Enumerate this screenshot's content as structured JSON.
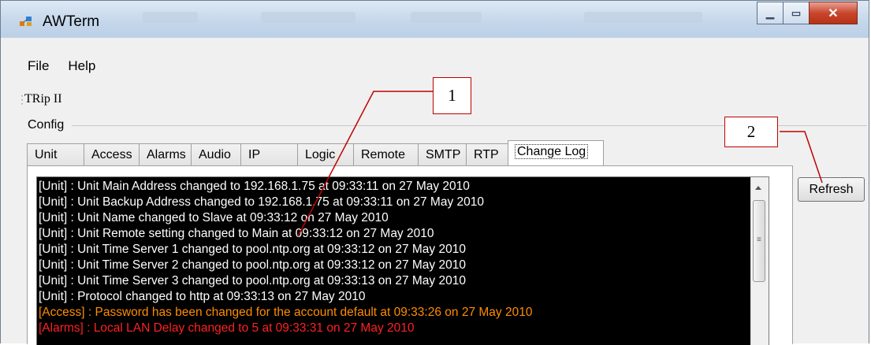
{
  "window": {
    "title": "AWTerm"
  },
  "menu": {
    "items": [
      "File",
      "Help"
    ]
  },
  "toolstrip": {
    "item": "TRip II"
  },
  "group": {
    "label": "Config"
  },
  "tabs": [
    "Unit",
    "Access",
    "Alarms",
    "Audio",
    "IP",
    "Logic",
    "Remote",
    "SMTP",
    "RTP",
    "Change Log"
  ],
  "active_tab": "Change Log",
  "log": [
    {
      "text": "[Unit] : Unit Main Address changed to 192.168.1.75 at 09:33:11 on 27 May 2010",
      "color": "#ffffff"
    },
    {
      "text": "[Unit] : Unit Backup Address changed to 192.168.1.75 at 09:33:11 on 27 May 2010",
      "color": "#ffffff"
    },
    {
      "text": "[Unit] : Unit Name changed to Slave at 09:33:12 on 27 May 2010",
      "color": "#ffffff"
    },
    {
      "text": "[Unit] : Unit Remote setting changed to Main at 09:33:12 on 27 May 2010",
      "color": "#ffffff"
    },
    {
      "text": "[Unit] : Unit Time Server 1 changed to pool.ntp.org at 09:33:12 on 27 May 2010",
      "color": "#ffffff"
    },
    {
      "text": "[Unit] : Unit Time Server 2 changed to pool.ntp.org at 09:33:12 on 27 May 2010",
      "color": "#ffffff"
    },
    {
      "text": "[Unit] : Unit Time Server 3 changed to pool.ntp.org at 09:33:13 on 27 May 2010",
      "color": "#ffffff"
    },
    {
      "text": "[Unit] : Protocol changed to http at 09:33:13 on 27 May 2010",
      "color": "#ffffff"
    },
    {
      "text": "[Access] : Password has been changed for the account default at 09:33:26 on 27 May 2010",
      "color": "#ff8c00"
    },
    {
      "text": "[Alarms] : Local LAN Delay changed to 5 at 09:33:31 on 27 May 2010",
      "color": "#ff2020"
    }
  ],
  "refresh_button": "Refresh",
  "callouts": [
    "1",
    "2"
  ],
  "colors": {
    "callout": "#c00000",
    "log_bg": "#000000",
    "title_gradient": "#c4d6ea"
  }
}
